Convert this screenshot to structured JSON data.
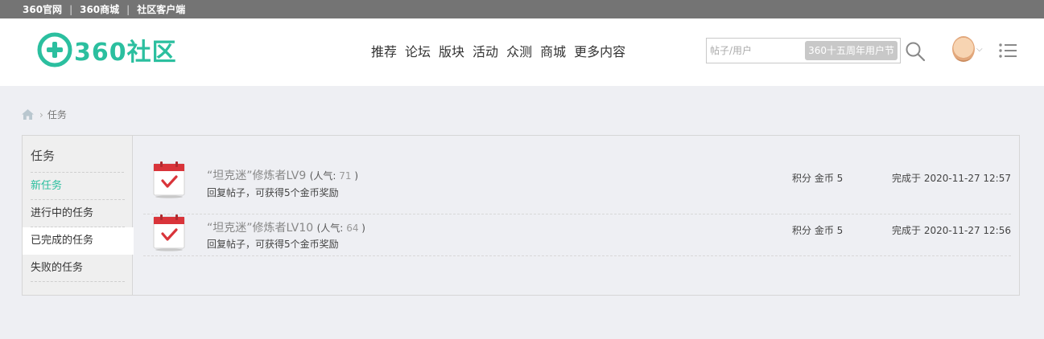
{
  "topbar": {
    "links": [
      "360官网",
      "360商城",
      "社区客户端"
    ],
    "separator": "|"
  },
  "header": {
    "logo_text": "360社区",
    "nav": [
      "推荐",
      "论坛",
      "版块",
      "活动",
      "众测",
      "商城",
      "更多内容"
    ],
    "search": {
      "placeholder": "帖子/用户",
      "tag": "360十五周年用户节"
    }
  },
  "breadcrumb": {
    "current": "任务"
  },
  "sidebar": {
    "title": "任务",
    "items": [
      {
        "label": "新任务"
      },
      {
        "label": "进行中的任务"
      },
      {
        "label": "已完成的任务"
      },
      {
        "label": "失败的任务"
      }
    ]
  },
  "tasks": [
    {
      "title": "“坦克迷”修炼者LV9",
      "popularity_label": "(人气:",
      "popularity": "71",
      "popularity_close": ")",
      "desc": "回复帖子，可获得5个金币奖励",
      "reward": "积分 金币 5",
      "completed": "完成于 2020-11-27 12:57"
    },
    {
      "title": "“坦克迷”修炼者LV10",
      "popularity_label": "(人气:",
      "popularity": "64",
      "popularity_close": ")",
      "desc": "回复帖子，可获得5个金币奖励",
      "reward": "积分 金币 5",
      "completed": "完成于 2020-11-27 12:56"
    }
  ],
  "colors": {
    "brand": "#2bbf9f",
    "topbar": "#747474",
    "page_bg": "#eeeff3",
    "calendar_red": "#d9343a"
  },
  "icons": [
    "plus-logo-icon",
    "search-icon",
    "chevron-down-icon",
    "list-menu-icon",
    "home-icon",
    "calendar-check-icon"
  ]
}
